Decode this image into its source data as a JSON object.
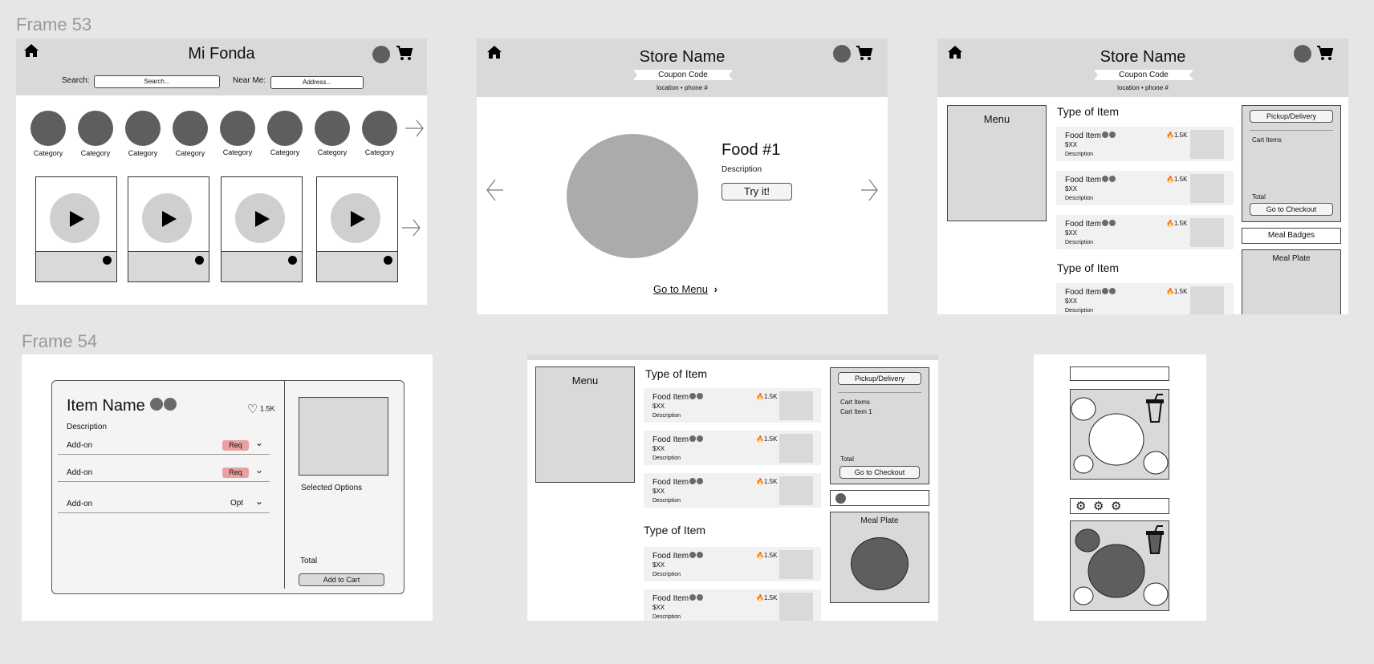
{
  "frames": {
    "top_label": "Frame 53",
    "bottom_label": "Frame 54"
  },
  "home": {
    "title": "Mi Fonda",
    "search_label": "Search:",
    "search_placeholder": "Search...",
    "near_label": "Near Me:",
    "address_placeholder": "Address...",
    "category_label": "Category"
  },
  "store": {
    "name": "Store Name",
    "coupon": "Coupon Code",
    "location": "location",
    "phone": "phone #",
    "food_title": "Food #1",
    "food_desc": "Description",
    "try_button": "Try it!",
    "go_to_menu": "Go to Menu"
  },
  "menu_page": {
    "menu_label": "Menu",
    "type_of_item": "Type of Item",
    "food_item": "Food Item",
    "price": "$XX",
    "description": "Description",
    "popularity": "1.5K",
    "pickup_delivery": "Pickup/Delivery",
    "cart_items": "Cart Items",
    "cart_item_1": "Cart Item 1",
    "total": "Total",
    "checkout": "Go to Checkout",
    "meal_badges": "Meal Badges",
    "meal_plate": "Meal Plate"
  },
  "item_detail": {
    "name": "Item Name",
    "likes": "1.5K",
    "description": "Description",
    "addon": "Add-on",
    "req": "Req",
    "opt": "Opt",
    "selected_options": "Selected Options",
    "total": "Total",
    "add_to_cart": "Add to Cart"
  },
  "colors": {
    "background": "#e6e6e6",
    "header_gray": "#d9d9d9",
    "dark_circle": "#5e5e5e",
    "req_badge": "#e8a0a0",
    "fire": "#f08a24"
  },
  "icons": [
    "home-icon",
    "cart-icon",
    "play-icon",
    "arrow-right-icon",
    "arrow-left-icon",
    "chevron-down-icon",
    "heart-icon",
    "fire-icon",
    "cup-icon",
    "badge-icon"
  ]
}
